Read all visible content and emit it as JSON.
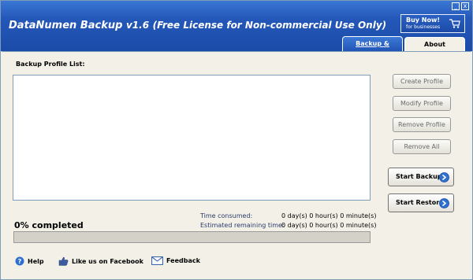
{
  "window": {
    "brand_a": "DataNumen",
    "brand_b": "Backup",
    "version": "v1.6",
    "license": "(Free License for Non-commercial Use Only)",
    "minimize": "_",
    "close": "x"
  },
  "buy": {
    "line1": "Buy Now!",
    "line2": "for businesses",
    "icon": "cart-icon"
  },
  "tabs": [
    {
      "label": "Backup & Restore",
      "active": true
    },
    {
      "label": "About",
      "active": false
    }
  ],
  "profile_list": {
    "label": "Backup Profile List:",
    "items": []
  },
  "side_buttons": {
    "create": "Create Profile",
    "modify": "Modify Profile",
    "remove": "Remove Profile",
    "remove_all": "Remove All"
  },
  "actions": {
    "start_backup": "Start Backup",
    "start_restore": "Start Restore"
  },
  "progress": {
    "label": "0% completed",
    "value": 0
  },
  "time": {
    "consumed_label": "Time consumed:",
    "consumed_value": "0 day(s) 0 hour(s) 0 minute(s)",
    "remaining_label": "Estimated remaining time:",
    "remaining_value": "0 day(s) 0 hour(s) 0 minute(s)"
  },
  "footer": {
    "help": "Help",
    "facebook": "Like us on Facebook",
    "feedback": "Feedback"
  },
  "colors": {
    "title_bar": "#2458b8",
    "accent": "#3a77d4",
    "surface": "#f2f0e7"
  }
}
